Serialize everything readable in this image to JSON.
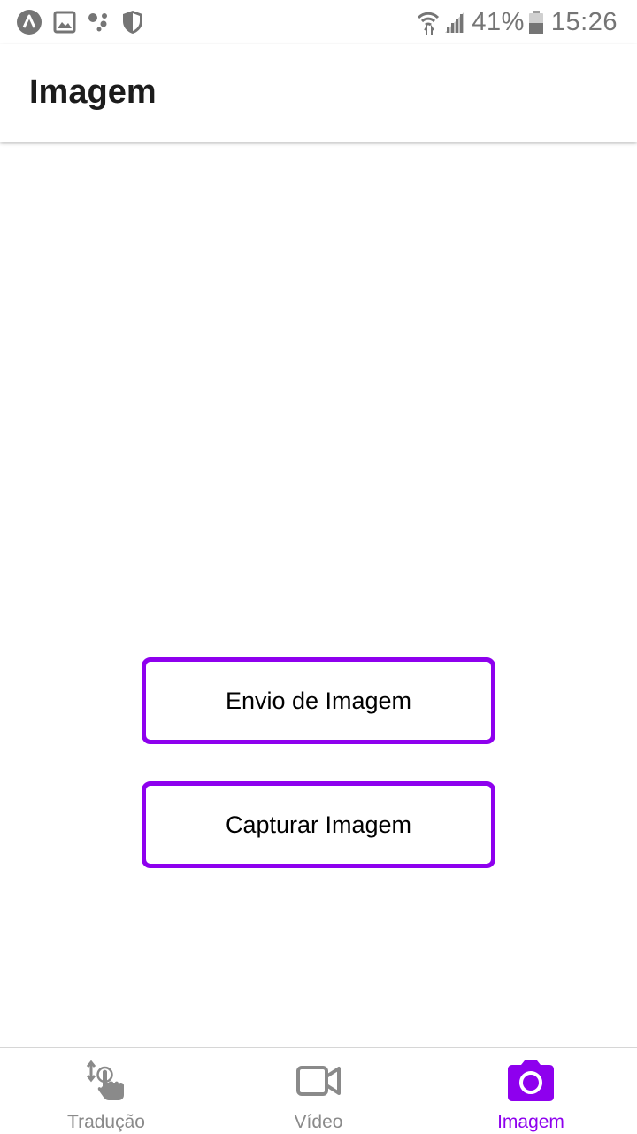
{
  "status_bar": {
    "left_icons": [
      "app-logo-icon",
      "image-icon",
      "assistant-dots-icon",
      "shield-icon"
    ],
    "right_icons": [
      "wifi-icon",
      "signal-icon"
    ],
    "battery_percent": "41%",
    "battery_icon": "battery-icon",
    "time": "15:26"
  },
  "app_bar": {
    "title": "Imagem"
  },
  "main": {
    "buttons": [
      {
        "label": "Envio de Imagem"
      },
      {
        "label": "Capturar Imagem"
      }
    ]
  },
  "bottom_nav": {
    "items": [
      {
        "label": "Tradução",
        "icon": "swipe-touch-icon",
        "active": false
      },
      {
        "label": "Vídeo",
        "icon": "videocam-icon",
        "active": false
      },
      {
        "label": "Imagem",
        "icon": "camera-icon",
        "active": true
      }
    ]
  },
  "colors": {
    "accent": "#8e00ee",
    "inactive": "#8a8a8a",
    "status_icons": "#757575",
    "background": "#ffffff"
  }
}
